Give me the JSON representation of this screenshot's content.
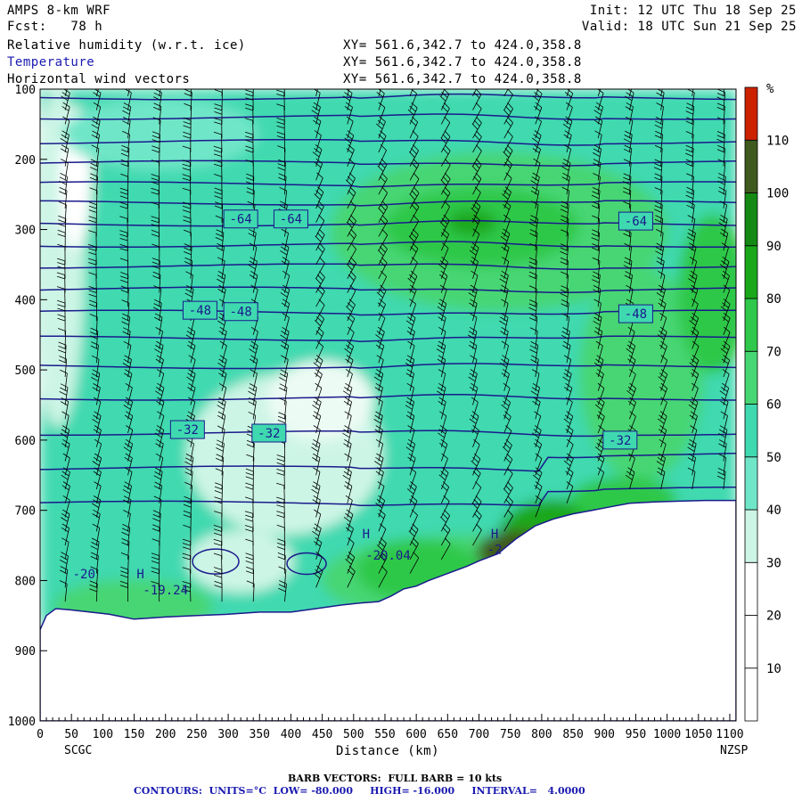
{
  "header": {
    "model": "AMPS 8-km WRF",
    "forecast": "Fcst:   78 h",
    "init": "Init: 12 UTC Thu 18 Sep 25",
    "valid": "Valid: 18 UTC Sun 21 Sep 25",
    "field1": "Relative humidity (w.r.t. ice)",
    "field2": "Temperature",
    "field3": "Horizontal wind vectors",
    "xy1": "XY= 561.6,342.7 to 424.0,358.8",
    "xy2": "XY= 561.6,342.7 to 424.0,358.8",
    "xy3": "XY= 561.6,342.7 to 424.0,358.8"
  },
  "footer": {
    "barb": "BARB VECTORS:  FULL BARB = 10 kts",
    "contours": "CONTOURS:  UNITS=°C  LOW= -80.000     HIGH= -16.000     INTERVAL=   4.0000"
  },
  "colors": {
    "temp_contour": "#1a1a8c",
    "rh_scale": [
      "#ffffff",
      "#ffffff",
      "#ffffff",
      "#cdf5e6",
      "#70e6c8",
      "#3fd9b0",
      "#46d673",
      "#2fc84a",
      "#1aa81a",
      "#148a14",
      "#3f5a1e",
      "#cc2200"
    ]
  },
  "chart_data": {
    "type": "heatmap",
    "title": "Relative humidity (w.r.t. ice)",
    "xlabel": "Distance (km)",
    "ylabel": "",
    "xlim": [
      0,
      1110
    ],
    "ylim": [
      1000,
      100
    ],
    "y_scale": "reversed",
    "x_ticks": [
      0,
      50,
      100,
      150,
      200,
      250,
      300,
      350,
      400,
      450,
      500,
      550,
      600,
      650,
      700,
      750,
      800,
      850,
      900,
      950,
      1000,
      1050,
      1100
    ],
    "y_ticks": [
      100,
      200,
      300,
      400,
      500,
      600,
      700,
      800,
      900,
      1000
    ],
    "x_endpoints": {
      "left": "SCGC",
      "right": "NZSP"
    },
    "colorbar": {
      "unit": "%",
      "ticks": [
        10,
        20,
        30,
        40,
        50,
        60,
        70,
        80,
        90,
        100,
        110
      ]
    },
    "temperature_labels": [
      {
        "x": 320,
        "p": 285,
        "text": "-64"
      },
      {
        "x": 400,
        "p": 285,
        "text": "-64"
      },
      {
        "x": 950,
        "p": 288,
        "text": "-64"
      },
      {
        "x": 255,
        "p": 415,
        "text": "-48"
      },
      {
        "x": 320,
        "p": 417,
        "text": "-48"
      },
      {
        "x": 950,
        "p": 420,
        "text": "-48"
      },
      {
        "x": 235,
        "p": 585,
        "text": "-32"
      },
      {
        "x": 365,
        "p": 590,
        "text": "-32"
      },
      {
        "x": 925,
        "p": 600,
        "text": "-32"
      }
    ],
    "extrema_labels": [
      {
        "x": 70,
        "p": 797,
        "text": "-20"
      },
      {
        "x": 160,
        "p": 797,
        "text": "H"
      },
      {
        "x": 200,
        "p": 820,
        "text": "-19.24"
      },
      {
        "x": 520,
        "p": 740,
        "text": "H"
      },
      {
        "x": 555,
        "p": 770,
        "text": "-20.04"
      },
      {
        "x": 725,
        "p": 740,
        "text": "H"
      },
      {
        "x": 725,
        "p": 762,
        "text": "-2"
      }
    ],
    "terrain_max": "-19.24"
  }
}
